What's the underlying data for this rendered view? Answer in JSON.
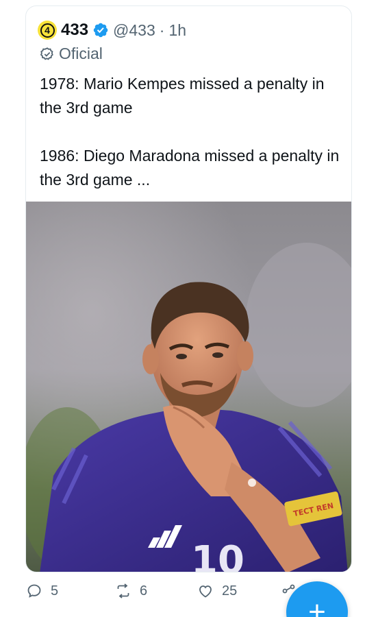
{
  "tweet": {
    "logo_text": "4",
    "account_name": "433",
    "handle": "@433",
    "separator": "·",
    "time": "1h",
    "official_label": "Oficial",
    "paragraphs": [
      "1978: Mario Kempes missed a penalty in the 3rd game",
      "1986: Diego Maradona missed a penalty in the 3rd game ..."
    ]
  },
  "photo": {
    "armband_text": "TECT REN",
    "shirt_number": "10"
  },
  "actions": {
    "replies": "5",
    "retweets": "6",
    "likes": "25"
  },
  "compose": {
    "label": "+"
  },
  "colors": {
    "accent": "#1d9bf0",
    "secondary_text": "#536471",
    "logo_yellow": "#f7e23a",
    "jersey": "#3b2d8f"
  },
  "icons": [
    "verified-badge-icon",
    "official-check-icon",
    "reply-icon",
    "retweet-icon",
    "like-icon",
    "share-icon",
    "compose-icon"
  ]
}
